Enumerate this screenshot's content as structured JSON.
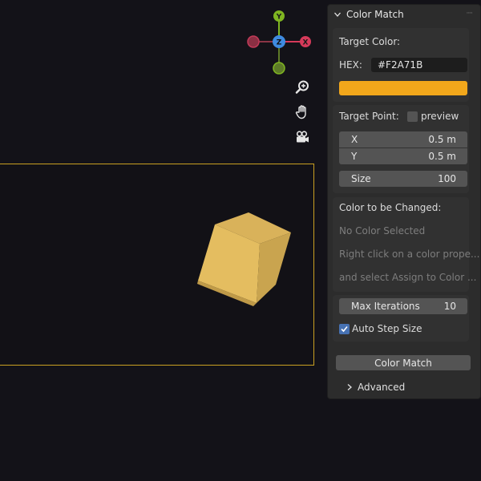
{
  "gizmo": {
    "y_label": "Y",
    "z_label": "Z",
    "x_label": "X"
  },
  "panel": {
    "title": "Color Match",
    "target_color": {
      "heading": "Target Color:",
      "hex_label": "HEX:",
      "hex_value": "#F2A71B",
      "swatch_color": "#F2A71B"
    },
    "target_point": {
      "heading": "Target Point:",
      "preview_label": "preview",
      "preview_checked": false,
      "x_label": "X",
      "x_value": "0.5 m",
      "y_label": "Y",
      "y_value": "0.5 m",
      "size_label": "Size",
      "size_value": "100"
    },
    "color_to_change": {
      "heading": "Color to be Changed:",
      "status": "No Color Selected",
      "hint_line1": "Right click on a color prope...",
      "hint_line2": "and select Assign to Color ..."
    },
    "max_iterations_label": "Max Iterations",
    "max_iterations_value": "10",
    "auto_step_label": "Auto Step Size",
    "auto_step_checked": true,
    "color_match_button": "Color Match",
    "advanced_label": "Advanced"
  },
  "colors": {
    "accent_blue": "#4772b3",
    "axis_x": "#d63a5a",
    "axis_y": "#7fb521",
    "axis_z": "#3f8be0",
    "camera_border": "#c9a021",
    "cube": "#e9c05f"
  },
  "icons": [
    "zoom-icon",
    "hand-pan-icon",
    "camera-icon",
    "chevron-down-icon",
    "chevron-right-icon",
    "checkmark-icon"
  ]
}
